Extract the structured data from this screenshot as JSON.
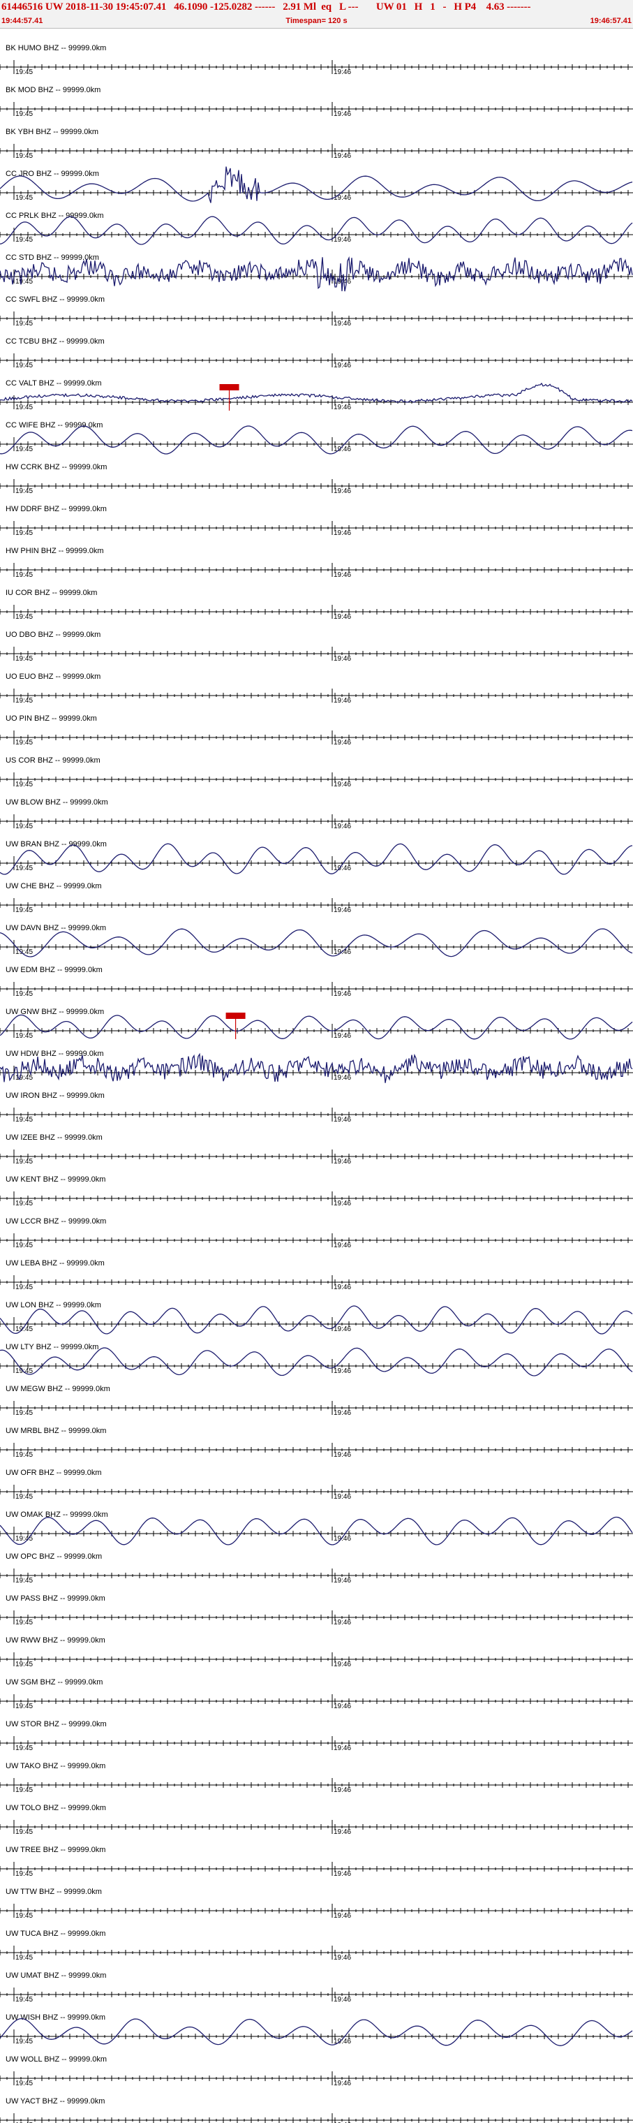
{
  "header": {
    "title": "61446516 UW 2018-11-30 19:45:07.41   46.1090 -125.0282 ------   2.91 Ml  eq   L ---       UW 01   H   1   -   H P4    4.63 -------",
    "start_time": "19:44:57.41",
    "timespan": "Timespan= 120 s",
    "end_time": "19:46:57.41"
  },
  "tick_labels": {
    "left": "19:45",
    "right": "19:46"
  },
  "trace_color": "#1c1c6e",
  "pick_color": "#cc0000",
  "channels": [
    {
      "label": "BK HUMO BHZ -- 99999.0km",
      "amp": 0,
      "kind": "flat"
    },
    {
      "label": "BK MOD BHZ -- 99999.0km",
      "amp": 0,
      "kind": "flat"
    },
    {
      "label": "BK YBH BHZ -- 99999.0km",
      "amp": 0,
      "kind": "flat"
    },
    {
      "label": "CC JRO BHZ -- 99999.0km",
      "amp": 18,
      "kind": "wave",
      "burst": 0.37
    },
    {
      "label": "CC PRLK BHZ -- 99999.0km",
      "amp": 20,
      "kind": "wave"
    },
    {
      "label": "CC STD BHZ -- 99999.0km",
      "amp": 18,
      "kind": "noisy",
      "burst": 0.53
    },
    {
      "label": "CC SWFL BHZ -- 99999.0km",
      "amp": 0,
      "kind": "flat"
    },
    {
      "label": "CC TCBU BHZ -- 99999.0km",
      "amp": 0,
      "kind": "flat"
    },
    {
      "label": "CC VALT BHZ -- 99999.0km",
      "amp": 14,
      "kind": "drift",
      "pick": 0.36
    },
    {
      "label": "CC WIFE BHZ -- 99999.0km",
      "amp": 20,
      "kind": "wave"
    },
    {
      "label": "HW CCRK BHZ -- 99999.0km",
      "amp": 0,
      "kind": "flat"
    },
    {
      "label": "HW DDRF BHZ -- 99999.0km",
      "amp": 0,
      "kind": "flat"
    },
    {
      "label": "HW PHIN BHZ -- 99999.0km",
      "amp": 0,
      "kind": "flat"
    },
    {
      "label": "IU COR BHZ -- 99999.0km",
      "amp": 0,
      "kind": "flat"
    },
    {
      "label": "UO DBO BHZ -- 99999.0km",
      "amp": 0,
      "kind": "flat"
    },
    {
      "label": "UO EUO BHZ -- 99999.0km",
      "amp": 0,
      "kind": "flat"
    },
    {
      "label": "UO PIN BHZ -- 99999.0km",
      "amp": 0,
      "kind": "flat"
    },
    {
      "label": "US COR BHZ -- 99999.0km",
      "amp": 0,
      "kind": "flat"
    },
    {
      "label": "UW BLOW BHZ -- 99999.0km",
      "amp": 0,
      "kind": "flat"
    },
    {
      "label": "UW BRAN BHZ -- 99999.0km",
      "amp": 22,
      "kind": "wave"
    },
    {
      "label": "UW CHE BHZ -- 99999.0km",
      "amp": 0,
      "kind": "flat"
    },
    {
      "label": "UW DAVN BHZ -- 99999.0km",
      "amp": 20,
      "kind": "wave"
    },
    {
      "label": "UW EDM BHZ -- 99999.0km",
      "amp": 0,
      "kind": "flat"
    },
    {
      "label": "UW GNW BHZ -- 99999.0km",
      "amp": 18,
      "kind": "wave",
      "pick": 0.37
    },
    {
      "label": "UW HDW BHZ -- 99999.0km",
      "amp": 18,
      "kind": "noisy"
    },
    {
      "label": "UW IRON BHZ -- 99999.0km",
      "amp": 0,
      "kind": "flat"
    },
    {
      "label": "UW IZEE BHZ -- 99999.0km",
      "amp": 0,
      "kind": "flat"
    },
    {
      "label": "UW KENT BHZ -- 99999.0km",
      "amp": 0,
      "kind": "flat"
    },
    {
      "label": "UW LCCR BHZ -- 99999.0km",
      "amp": 0,
      "kind": "flat"
    },
    {
      "label": "UW LEBA BHZ -- 99999.0km",
      "amp": 0,
      "kind": "flat"
    },
    {
      "label": "UW LON BHZ -- 99999.0km",
      "amp": 20,
      "kind": "wave"
    },
    {
      "label": "UW LTY BHZ -- 99999.0km",
      "amp": 20,
      "kind": "wave"
    },
    {
      "label": "UW MEGW BHZ -- 99999.0km",
      "amp": 0,
      "kind": "flat"
    },
    {
      "label": "UW MRBL BHZ -- 99999.0km",
      "amp": 0,
      "kind": "flat"
    },
    {
      "label": "UW OFR BHZ -- 99999.0km",
      "amp": 0,
      "kind": "flat"
    },
    {
      "label": "UW OMAK BHZ -- 99999.0km",
      "amp": 22,
      "kind": "wave"
    },
    {
      "label": "UW OPC BHZ -- 99999.0km",
      "amp": 0,
      "kind": "flat"
    },
    {
      "label": "UW PASS BHZ -- 99999.0km",
      "amp": 0,
      "kind": "flat"
    },
    {
      "label": "UW RWW BHZ -- 99999.0km",
      "amp": 0,
      "kind": "flat"
    },
    {
      "label": "UW SGM BHZ -- 99999.0km",
      "amp": 0,
      "kind": "flat"
    },
    {
      "label": "UW STOR BHZ -- 99999.0km",
      "amp": 0,
      "kind": "flat"
    },
    {
      "label": "UW TAKO BHZ -- 99999.0km",
      "amp": 0,
      "kind": "flat"
    },
    {
      "label": "UW TOLO BHZ -- 99999.0km",
      "amp": 0,
      "kind": "flat"
    },
    {
      "label": "UW TREE BHZ -- 99999.0km",
      "amp": 0,
      "kind": "flat"
    },
    {
      "label": "UW TTW BHZ -- 99999.0km",
      "amp": 0,
      "kind": "flat"
    },
    {
      "label": "UW TUCA BHZ -- 99999.0km",
      "amp": 0,
      "kind": "flat"
    },
    {
      "label": "UW UMAT BHZ -- 99999.0km",
      "amp": 0,
      "kind": "flat"
    },
    {
      "label": "UW WISH BHZ -- 99999.0km",
      "amp": 20,
      "kind": "wave"
    },
    {
      "label": "UW WOLL BHZ -- 99999.0km",
      "amp": 0,
      "kind": "flat"
    },
    {
      "label": "UW YACT BHZ -- 99999.0km",
      "amp": 0,
      "kind": "flat"
    }
  ]
}
